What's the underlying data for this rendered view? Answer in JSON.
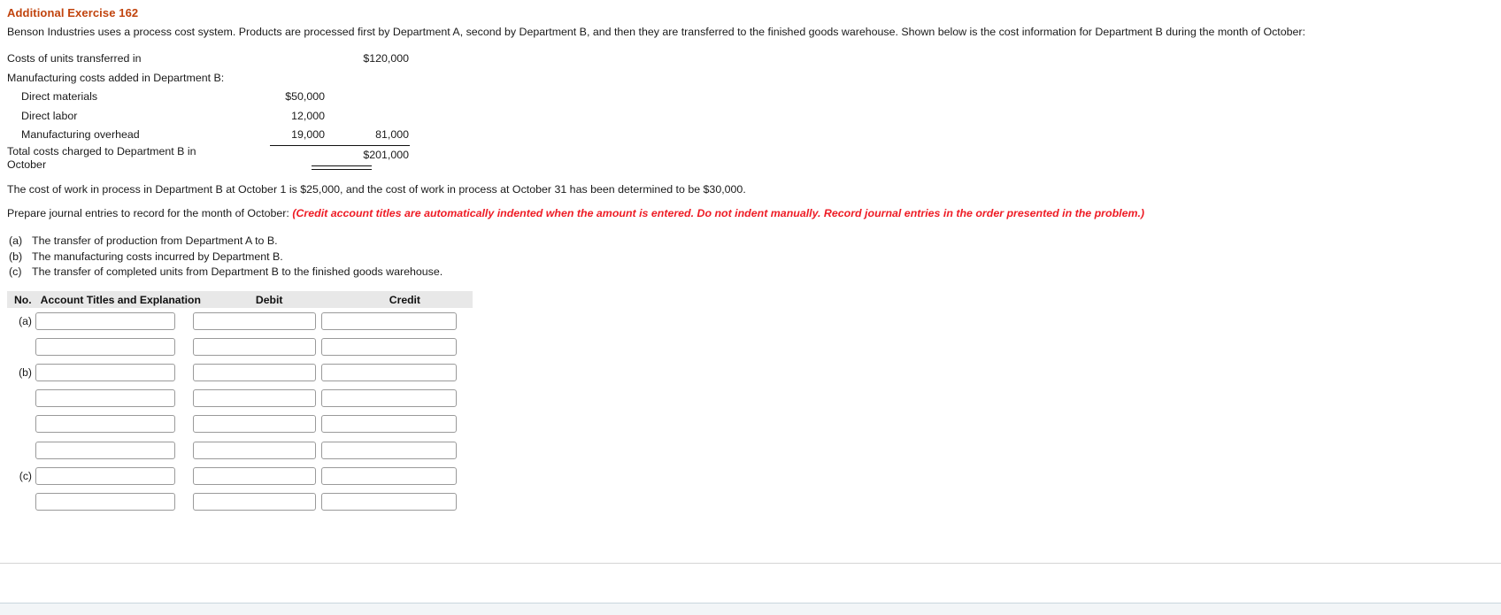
{
  "exercise": {
    "title": "Additional Exercise 162",
    "title_color": "#c1440e",
    "intro": "Benson Industries uses a process cost system. Products are processed first by Department A, second by Department B, and then they are transferred to the finished goods warehouse. Shown below is the cost information for Department B during the month of October:"
  },
  "cost_table": {
    "rows": [
      {
        "label": "Costs of units transferred in",
        "col1": "",
        "col2": "$120,000"
      },
      {
        "label": "Manufacturing costs added in Department B:",
        "col1": "",
        "col2": ""
      },
      {
        "label": "Direct materials",
        "col1": "$50,000",
        "col2": ""
      },
      {
        "label": "Direct labor",
        "col1": "12,000",
        "col2": ""
      },
      {
        "label": "Manufacturing overhead",
        "col1": "19,000",
        "col2": "81,000"
      }
    ],
    "total_label": "Total costs charged to Department B in October",
    "total_value": "$201,000"
  },
  "wip": {
    "text": "The cost of work in process in Department B at October 1 is $25,000, and the cost of work in process at October 31 has been determined to be $30,000."
  },
  "prepare": {
    "lead": "Prepare journal entries to record for the month of October:",
    "hint": "(Credit account titles are automatically indented when the amount is entered. Do not indent manually. Record journal entries in the order presented in the problem.)",
    "hint_color": "#ee1c25"
  },
  "requirements": [
    {
      "marker": "(a)",
      "text": "The transfer of production from Department A to B."
    },
    {
      "marker": "(b)",
      "text": "The manufacturing costs incurred by Department B."
    },
    {
      "marker": "(c)",
      "text": "The transfer of completed units from Department B to the finished goods warehouse."
    }
  ],
  "journal": {
    "headers": {
      "no": "No.",
      "account": "Account Titles and Explanation",
      "debit": "Debit",
      "credit": "Credit"
    },
    "rows": [
      {
        "no": "(a)",
        "account": "",
        "debit": "",
        "credit": ""
      },
      {
        "no": "",
        "account": "",
        "debit": "",
        "credit": ""
      },
      {
        "no": "(b)",
        "account": "",
        "debit": "",
        "credit": ""
      },
      {
        "no": "",
        "account": "",
        "debit": "",
        "credit": ""
      },
      {
        "no": "",
        "account": "",
        "debit": "",
        "credit": ""
      },
      {
        "no": "",
        "account": "",
        "debit": "",
        "credit": ""
      },
      {
        "no": "(c)",
        "account": "",
        "debit": "",
        "credit": ""
      },
      {
        "no": "",
        "account": "",
        "debit": "",
        "credit": ""
      }
    ]
  }
}
